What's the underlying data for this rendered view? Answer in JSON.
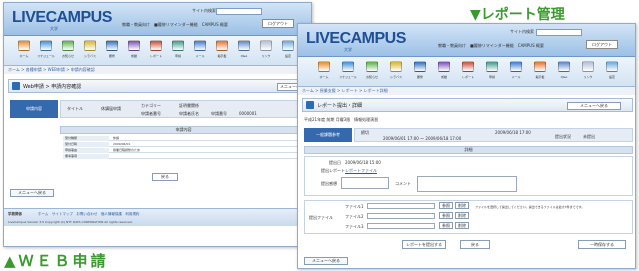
{
  "captions": {
    "right": "▼レポート管理",
    "left": "▲ＷＥＢ申請"
  },
  "app": {
    "logo": "LIVECAMPUS",
    "logo_sub": "大学",
    "search_label": "サイト内検索",
    "header_links": "教職・教員向け　■履修リマインダー機能　CAMPUS 概要",
    "logout": "ログアウト"
  },
  "icons": [
    {
      "name": "home-icon",
      "label": "ホーム",
      "color": "#e88a2a"
    },
    {
      "name": "schedule-icon",
      "label": "スケジュール",
      "color": "#3d8fd6"
    },
    {
      "name": "info-icon",
      "label": "お知らせ",
      "color": "#5ab04a"
    },
    {
      "name": "syllabus-icon",
      "label": "シラバス",
      "color": "#d6b62c"
    },
    {
      "name": "course-icon",
      "label": "履修",
      "color": "#2e6fbd"
    },
    {
      "name": "grade-icon",
      "label": "成績",
      "color": "#7a4fb6"
    },
    {
      "name": "report-icon",
      "label": "レポート",
      "color": "#c94c3a"
    },
    {
      "name": "apply-icon",
      "label": "申請",
      "color": "#3e9a8a"
    },
    {
      "name": "mail-icon",
      "label": "メール",
      "color": "#3c7bd1"
    },
    {
      "name": "bbs-icon",
      "label": "掲示板",
      "color": "#e6702c"
    },
    {
      "name": "qa-icon",
      "label": "Q&A",
      "color": "#5c86c8"
    },
    {
      "name": "link-icon",
      "label": "リンク",
      "color": "#b0bfd6"
    },
    {
      "name": "setting-icon",
      "label": "設定",
      "color": "#6aa8e0"
    }
  ],
  "left_window": {
    "breadcrumb": "ホーム > 各種申請 > WEB申請 > 申請内容確認",
    "page_title": "Web申請 > 申請内容確認",
    "menu_button": "メニューへ",
    "tab_label": "申請内容",
    "table": {
      "col1": "タイトル",
      "col1_value": "休講届申請",
      "col2": "カテゴリー",
      "col2_value": "証明書関係",
      "col3": "申請番号",
      "col3_value": "0000001",
      "row2_a": "申請者番号",
      "row2_b": "申請者氏名"
    },
    "section_title": "申請内容",
    "rows": [
      {
        "label": "受付種類",
        "value": "休講"
      },
      {
        "label": "受付日時",
        "value": "2009/06/01"
      },
      {
        "label": "申請事由",
        "value": "授業日程調整のため"
      },
      {
        "label": "備考事項",
        "value": ""
      }
    ],
    "back_button": "戻る",
    "menu_link": "メニューへ戻る",
    "footer_label": "学務関係",
    "footer_links": "ホーム　サイトマップ　お問い合わせ　個人情報保護　利用規約",
    "footer_copy": "LiveCampus Version 3.5 Copyright (C) NTT DATA CORPORATION All rights reserved."
  },
  "right_window": {
    "breadcrumb": "ホーム > 授業支援 > レポート > レポート詳細",
    "page_title": "レポート提出・詳細",
    "menu_button": "メニューへ戻る",
    "course_line": "平成21年度 前期 月曜3限　情報処理演習",
    "report_kind": "一般課題参考",
    "deadline_label": "締切",
    "deadline_value": "2009/06/18 17:00",
    "period": "2009/06/01 17:00 ～ 2009/06/18 17:00",
    "status_label": "提出状況",
    "status_value": "未提出",
    "section_title": "詳細",
    "detail": {
      "row1_label": "提出日",
      "row1_value": "2009/06/18 15:00",
      "row2_label": "提出レポート",
      "row2_value": "レポートファイル",
      "row3_label": "提出感想",
      "row3_sub": "コメント"
    },
    "files": {
      "label": "提出ファイル",
      "file1": "ファイル1",
      "file2": "ファイル2",
      "file3": "ファイル3",
      "browse": "参照",
      "delete": "削除",
      "note": "ファイルを選択して提出してください。提出できるファイルは最大3件までです。"
    },
    "submit_button": "レポートを提出する",
    "back_button": "戻る",
    "save_button": "一時保存する",
    "menu_link": "メニューへ戻る"
  }
}
